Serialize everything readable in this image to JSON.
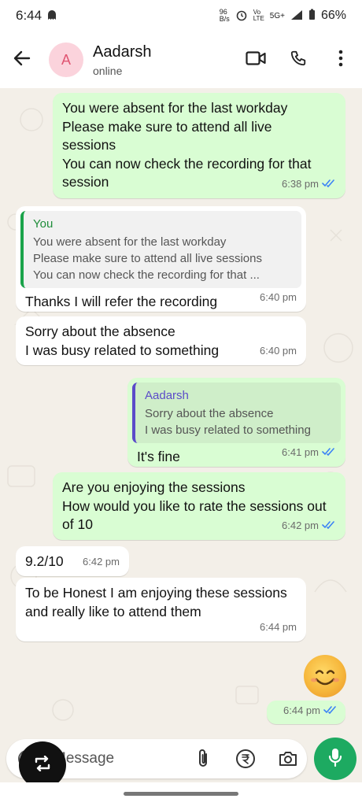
{
  "status_bar": {
    "time": "6:44",
    "indicators": "5G+",
    "battery": "66%",
    "icons": [
      "ghost-icon",
      "data-speed-icon",
      "alarm-icon",
      "volte-icon",
      "signal-icon",
      "battery-icon"
    ]
  },
  "header": {
    "avatar_initial": "A",
    "contact_name": "Aadarsh",
    "presence": "online",
    "icons": [
      "back-arrow-icon",
      "video-call-icon",
      "voice-call-icon",
      "more-options-icon"
    ]
  },
  "messages": [
    {
      "dir": "out",
      "text": "You were absent for the last workday\nPlease make sure to attend all live sessions\nYou can now check the recording for that session",
      "time": "6:38 pm",
      "read": true
    },
    {
      "dir": "in",
      "quote_name": "You",
      "quote_text": "You were absent for the last workday\nPlease make sure to attend all live sessions\nYou can now check the recording for that ...",
      "text": "Thanks I will refer the recording",
      "time": "6:40 pm"
    },
    {
      "dir": "in",
      "text": "Sorry about the absence\nI was busy related to something",
      "time": "6:40 pm"
    },
    {
      "dir": "out",
      "quote_name": "Aadarsh",
      "quote_text": "Sorry about the absence\nI was busy related to something",
      "text": "It's fine",
      "time": "6:41 pm",
      "read": true
    },
    {
      "dir": "out",
      "text": "Are you enjoying the sessions\nHow would you like to rate the sessions out of 10",
      "time": "6:42 pm",
      "read": true
    },
    {
      "dir": "in",
      "text": "9.2/10",
      "time": "6:42 pm"
    },
    {
      "dir": "in",
      "text": "To be Honest I am enjoying these sessions and really like to attend them",
      "time": "6:44 pm"
    },
    {
      "dir": "out",
      "sticker": "smiling-face-emoji",
      "time": "6:44 pm",
      "read": true
    }
  ],
  "composer": {
    "placeholder": "Message",
    "icons": [
      "emoji-icon",
      "attach-icon",
      "rupee-payment-icon",
      "camera-icon",
      "mic-icon"
    ]
  },
  "colors": {
    "outgoing_bubble": "#d9fdd3",
    "incoming_bubble": "#ffffff",
    "wallpaper": "#f3efe8",
    "accent_green": "#1daa61",
    "read_ticks": "#3b82f6"
  }
}
